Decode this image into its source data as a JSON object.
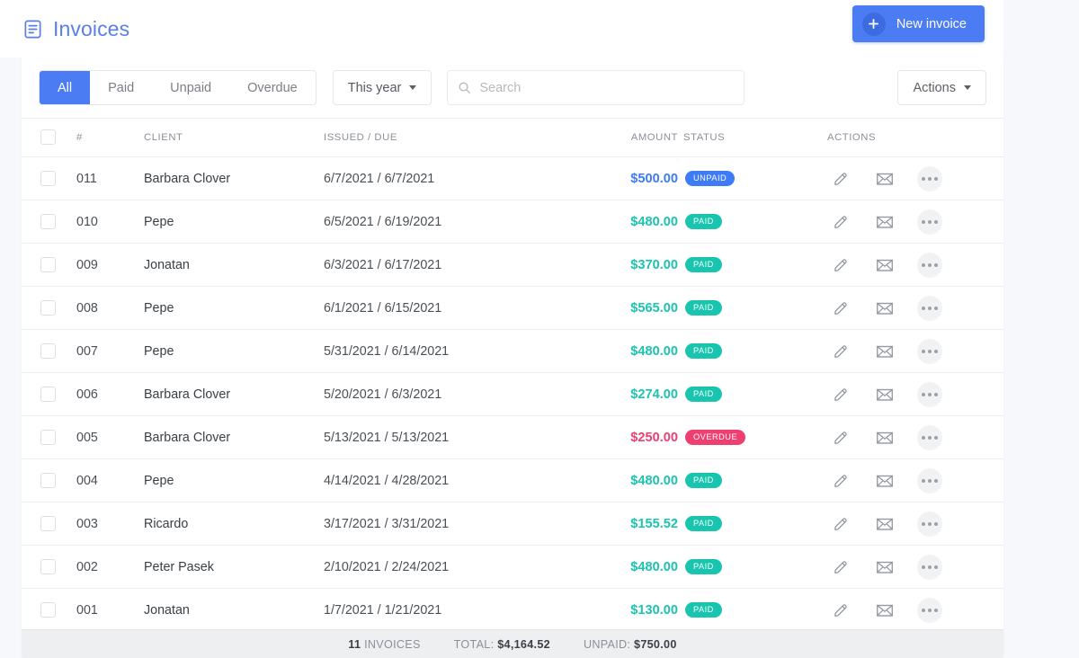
{
  "header": {
    "title": "Invoices",
    "icon": "document-lines-icon",
    "new_invoice_label": "New invoice",
    "new_invoice_icon": "plus-icon",
    "accent_color": "#4c7cf3",
    "title_color": "#5a80e8"
  },
  "toolbar": {
    "filters": [
      {
        "label": "All",
        "active": true
      },
      {
        "label": "Paid",
        "active": false
      },
      {
        "label": "Unpaid",
        "active": false
      },
      {
        "label": "Overdue",
        "active": false
      }
    ],
    "period_label": "This year",
    "period_icon": "chevron-down-icon",
    "search": {
      "value": "",
      "placeholder": "Search",
      "icon": "search-icon"
    },
    "actions_label": "Actions",
    "actions_icon": "chevron-down-icon"
  },
  "table": {
    "columns": [
      "#",
      "CLIENT",
      "ISSUED / DUE",
      "AMOUNT",
      "STATUS",
      "ACTIONS"
    ],
    "row_icons": [
      "pencil-icon",
      "envelope-icon",
      "more-options-icon"
    ],
    "rows": [
      {
        "number": "011",
        "client": "Barbara Clover",
        "dates": "6/7/2021 / 6/7/2021",
        "amount": "$500.00",
        "status": "UNPAID",
        "state": "unpaid"
      },
      {
        "number": "010",
        "client": "Pepe",
        "dates": "6/5/2021 / 6/19/2021",
        "amount": "$480.00",
        "status": "PAID",
        "state": "paid"
      },
      {
        "number": "009",
        "client": "Jonatan",
        "dates": "6/3/2021 / 6/17/2021",
        "amount": "$370.00",
        "status": "PAID",
        "state": "paid"
      },
      {
        "number": "008",
        "client": "Pepe",
        "dates": "6/1/2021 / 6/15/2021",
        "amount": "$565.00",
        "status": "PAID",
        "state": "paid"
      },
      {
        "number": "007",
        "client": "Pepe",
        "dates": "5/31/2021 / 6/14/2021",
        "amount": "$480.00",
        "status": "PAID",
        "state": "paid"
      },
      {
        "number": "006",
        "client": "Barbara Clover",
        "dates": "5/20/2021 / 6/3/2021",
        "amount": "$274.00",
        "status": "PAID",
        "state": "paid"
      },
      {
        "number": "005",
        "client": "Barbara Clover",
        "dates": "5/13/2021 / 5/13/2021",
        "amount": "$250.00",
        "status": "OVERDUE",
        "state": "overdue"
      },
      {
        "number": "004",
        "client": "Pepe",
        "dates": "4/14/2021 / 4/28/2021",
        "amount": "$480.00",
        "status": "PAID",
        "state": "paid"
      },
      {
        "number": "003",
        "client": "Ricardo",
        "dates": "3/17/2021 / 3/31/2021",
        "amount": "$155.52",
        "status": "PAID",
        "state": "paid"
      },
      {
        "number": "002",
        "client": "Peter Pasek",
        "dates": "2/10/2021 / 2/24/2021",
        "amount": "$480.00",
        "status": "PAID",
        "state": "paid"
      },
      {
        "number": "001",
        "client": "Jonatan",
        "dates": "1/7/2021 / 1/21/2021",
        "amount": "$130.00",
        "status": "PAID",
        "state": "paid"
      }
    ]
  },
  "footer": {
    "count_value": "11",
    "count_label": "INVOICES",
    "total_label": "TOTAL:",
    "total_value": "$4,164.52",
    "unpaid_label": "UNPAID:",
    "unpaid_value": "$750.00"
  },
  "status_colors": {
    "paid": "#1ac5b0",
    "unpaid": "#3d7bf7",
    "overdue": "#ef3f71"
  }
}
